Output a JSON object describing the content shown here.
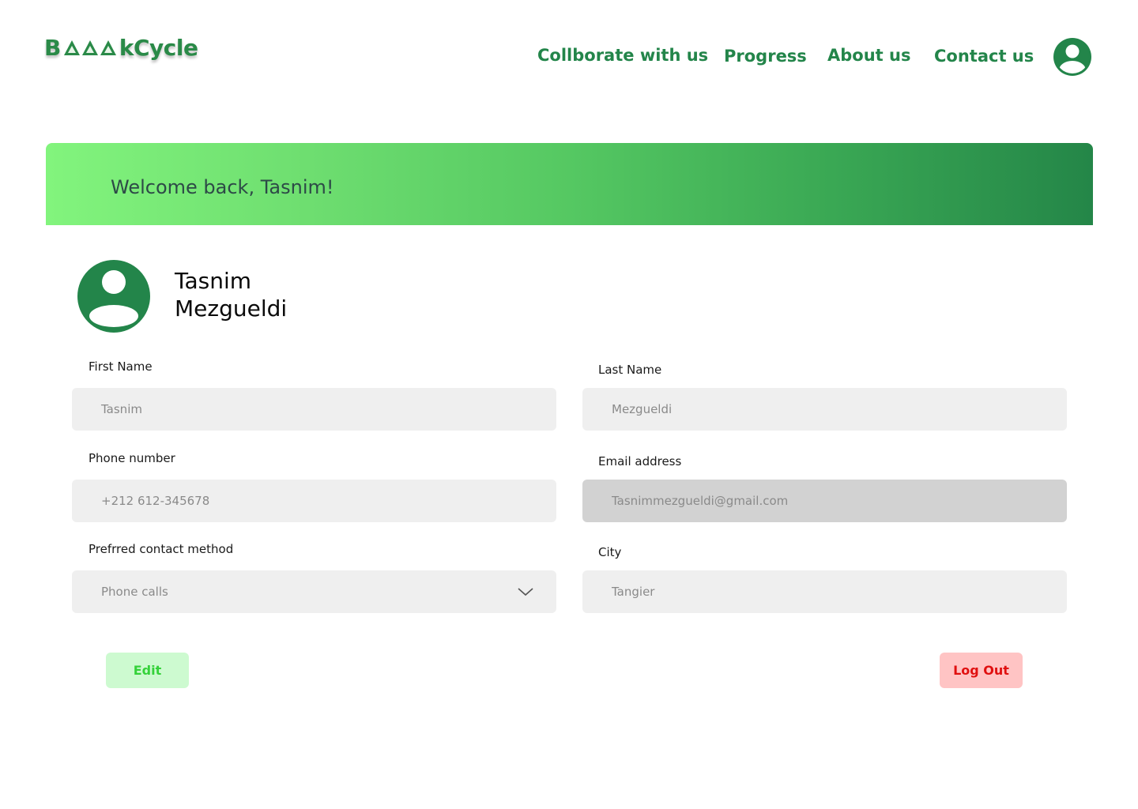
{
  "brand": {
    "logo_prefix": "B",
    "logo_suffix": "kCycle",
    "accent": "#23854a"
  },
  "nav": {
    "items": [
      {
        "label": "Collborate with us"
      },
      {
        "label": "Progress"
      },
      {
        "label": "About us"
      },
      {
        "label": "Contact us"
      }
    ],
    "profile_icon": "user-circle-icon"
  },
  "banner": {
    "text": "Welcome back, Tasnim!"
  },
  "profile": {
    "first_line": "Tasnim",
    "second_line": "Mezgueldi",
    "avatar_icon": "user-circle-icon"
  },
  "form": {
    "first_name": {
      "label": "First Name",
      "value": "Tasnim"
    },
    "last_name": {
      "label": "Last Name",
      "value": "Mezgueldi"
    },
    "phone": {
      "label": "Phone number",
      "value": "+212 612-345678"
    },
    "email": {
      "label": "Email address",
      "value": "Tasnimmezgueldi@gmail.com"
    },
    "contact_method": {
      "label": "Prefrred contact method",
      "value": "Phone calls",
      "icon": "chevron-down-icon"
    },
    "city": {
      "label": "City",
      "value": "Tangier"
    }
  },
  "actions": {
    "edit_label": "Edit",
    "logout_label": "Log Out"
  }
}
